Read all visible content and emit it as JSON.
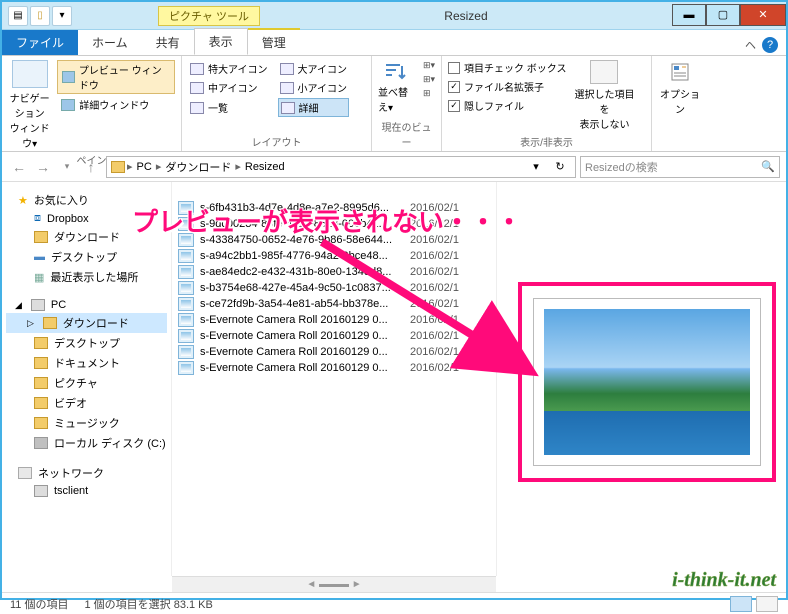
{
  "window": {
    "title": "Resized",
    "context_tab": "ピクチャ ツール"
  },
  "tabs": {
    "file": "ファイル",
    "home": "ホーム",
    "share": "共有",
    "view": "表示",
    "manage": "管理"
  },
  "ribbon": {
    "pane_group": {
      "nav_label": "ナビゲーション\nウィンドウ▾",
      "preview_label": "プレビュー ウィンドウ",
      "detail_label": "詳細ウィンドウ",
      "group_label": "ペイン"
    },
    "layout_group": {
      "extra_large": "特大アイコン",
      "large": "大アイコン",
      "medium": "中アイコン",
      "small": "小アイコン",
      "list": "一覧",
      "details": "詳細",
      "group_label": "レイアウト"
    },
    "current_view": {
      "sort_label": "並べ替え▾",
      "group_label": "現在のビュー"
    },
    "show_hide": {
      "check_boxes": "項目チェック ボックス",
      "extensions": "ファイル名拡張子",
      "hidden": "隠しファイル",
      "hide_selected": "選択した項目を\n表示しない",
      "group_label": "表示/非表示"
    },
    "options": {
      "label": "オプション"
    }
  },
  "breadcrumb": {
    "pc": "PC",
    "downloads": "ダウンロード",
    "resized": "Resized"
  },
  "search": {
    "placeholder": "Resizedの検索"
  },
  "sidebar": {
    "favorites": "お気に入り",
    "fav_items": [
      "Dropbox",
      "ダウンロード",
      "デスクトップ",
      "最近表示した場所"
    ],
    "pc": "PC",
    "pc_items": [
      "ダウンロード",
      "デスクトップ",
      "ドキュメント",
      "ピクチャ",
      "ビデオ",
      "ミュージック",
      "ローカル ディスク (C:)"
    ],
    "network": "ネットワーク",
    "net_items": [
      "tsclient"
    ]
  },
  "files": [
    {
      "name": "s-6fb431b3-4d7e-4d8e-a7e2-8995d6...",
      "date": "2016/02/1"
    },
    {
      "name": "s-9dc00234-80fe-40bc-8513-000b41...",
      "date": "2016/02/1"
    },
    {
      "name": "s-43384750-0652-4e76-9b86-58e644...",
      "date": "2016/02/1"
    },
    {
      "name": "s-a94c2bb1-985f-4776-94a2-0bce48...",
      "date": "2016/02/1"
    },
    {
      "name": "s-ae84edc2-e432-431b-80e0-134ed8...",
      "date": "2016/02/1"
    },
    {
      "name": "s-b3754e68-427e-45a4-9c50-1c0837...",
      "date": "2016/02/1"
    },
    {
      "name": "s-ce72fd9b-3a54-4e81-ab54-bb378e...",
      "date": "2016/02/1"
    },
    {
      "name": "s-Evernote Camera Roll 20160129 0...",
      "date": "2016/02/1"
    },
    {
      "name": "s-Evernote Camera Roll 20160129 0...",
      "date": "2016/02/1"
    },
    {
      "name": "s-Evernote Camera Roll 20160129 0...",
      "date": "2016/02/1"
    },
    {
      "name": "s-Evernote Camera Roll 20160129 0...",
      "date": "2016/02/1"
    }
  ],
  "status": {
    "count": "11 個の項目",
    "selected": "1 個の項目を選択 83.1 KB"
  },
  "annotation": "プレビューが表示されない・・・",
  "watermark": "i-think-it.net"
}
